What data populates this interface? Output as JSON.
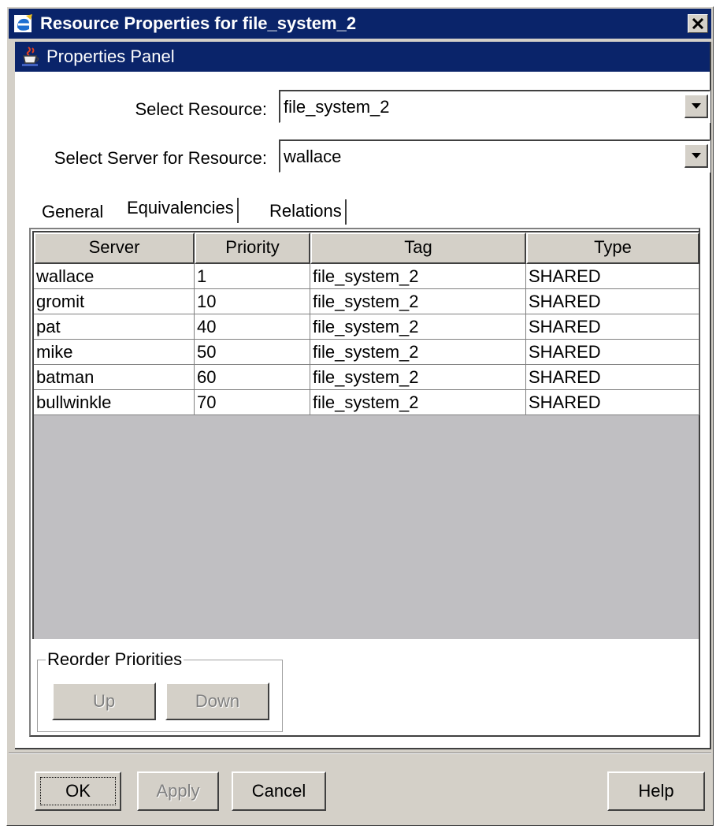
{
  "window": {
    "title": "Resource Properties for file_system_2",
    "icons": {
      "app": "java-app-icon",
      "close": "close-icon"
    }
  },
  "panel": {
    "title": "Properties Panel",
    "icon": "java-cup-icon"
  },
  "select_resource": {
    "label": "Select Resource:",
    "value": "file_system_2"
  },
  "select_server": {
    "label": "Select Server for Resource:",
    "value": "wallace"
  },
  "tabs": [
    {
      "label": "General",
      "selected": false
    },
    {
      "label": "Equivalencies",
      "selected": true
    },
    {
      "label": "Relations",
      "selected": false
    }
  ],
  "table": {
    "columns": [
      "Server",
      "Priority",
      "Tag",
      "Type"
    ],
    "rows": [
      [
        "wallace",
        "1",
        "file_system_2",
        "SHARED"
      ],
      [
        "gromit",
        "10",
        "file_system_2",
        "SHARED"
      ],
      [
        "pat",
        "40",
        "file_system_2",
        "SHARED"
      ],
      [
        "mike",
        "50",
        "file_system_2",
        "SHARED"
      ],
      [
        "batman",
        "60",
        "file_system_2",
        "SHARED"
      ],
      [
        "bullwinkle",
        "70",
        "file_system_2",
        "SHARED"
      ]
    ]
  },
  "reorder": {
    "label": "Reorder Priorities",
    "up_label": "Up",
    "down_label": "Down"
  },
  "footer": {
    "ok_label": "OK",
    "apply_label": "Apply",
    "cancel_label": "Cancel",
    "help_label": "Help"
  },
  "colors": {
    "titlebar": "#0a246a",
    "face": "#d4d0c8",
    "grid_empty": "#c0bfc2"
  }
}
